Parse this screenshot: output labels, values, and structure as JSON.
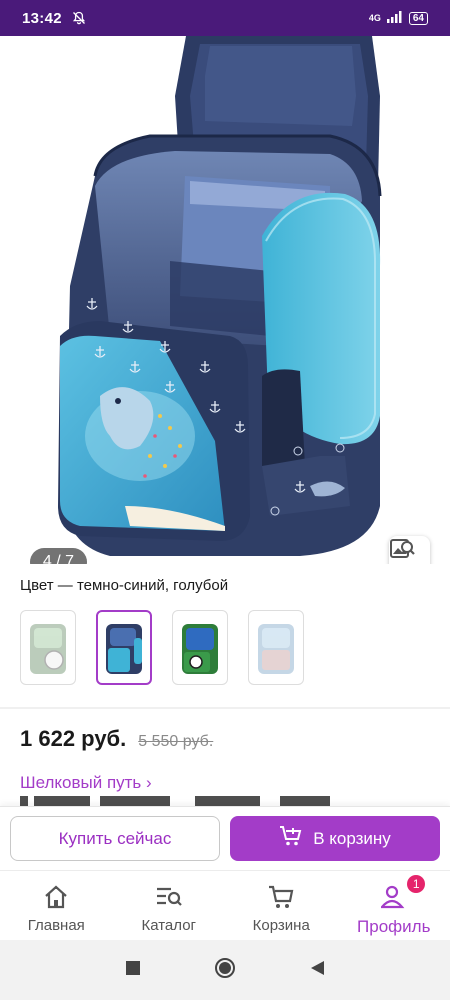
{
  "status_bar": {
    "time": "13:42",
    "network": "4G",
    "battery": "64"
  },
  "gallery": {
    "counter": "4 / 7"
  },
  "product": {
    "color_label": "Цвет — темно-синий, голубой",
    "price": "1 622 руб.",
    "old_price": "5 550 руб.",
    "seller": "Шелковый путь ›"
  },
  "actions": {
    "buy_now": "Купить сейчас",
    "add_to_cart": "В корзину"
  },
  "bottom_nav": {
    "items": [
      {
        "label": "Главная",
        "icon": "home-icon"
      },
      {
        "label": "Каталог",
        "icon": "catalog-search-icon"
      },
      {
        "label": "Корзина",
        "icon": "cart-icon"
      },
      {
        "label": "Профиль",
        "icon": "profile-icon",
        "badge": "1"
      }
    ],
    "active": "Профиль"
  },
  "colors": {
    "accent": "#a33cc8",
    "status_bar": "#4a1a7a",
    "badge": "#e5246b"
  }
}
